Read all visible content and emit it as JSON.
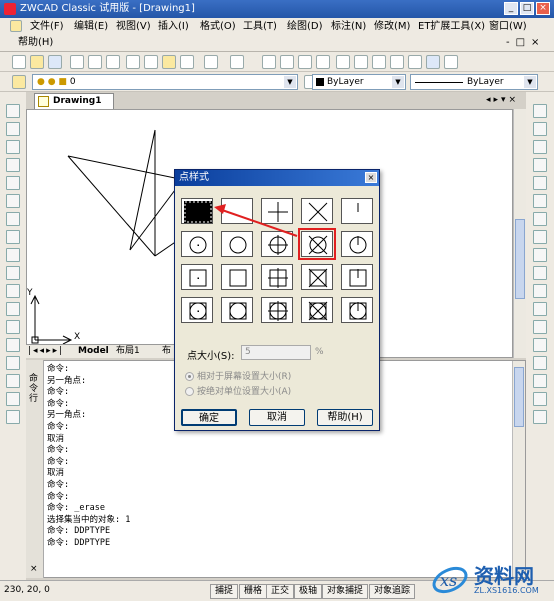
{
  "window": {
    "title": "ZWCAD Classic 试用版 - [Drawing1]"
  },
  "menu": {
    "row1": [
      "文件(F)",
      "编辑(E)",
      "视图(V)",
      "插入(I)",
      "格式(O)",
      "工具(T)",
      "绘图(D)",
      "标注(N)",
      "修改(M)",
      "ET扩展工具(X)",
      "窗口(W)"
    ],
    "row2": [
      "帮助(H)"
    ]
  },
  "properties_bar": {
    "layer_value": "0",
    "color_combo": "ByLayer",
    "linetype_combo": "ByLayer"
  },
  "document": {
    "tab_title": "Drawing1"
  },
  "layout_tabs": [
    "Model",
    "布局1",
    "布"
  ],
  "command_panel_label": "命令行",
  "command_lines": [
    "命令:",
    "另一角点:",
    "命令:",
    "命令:",
    "另一角点:",
    "命令:",
    "取消",
    "命令:",
    "命令:",
    "取消",
    "命令:",
    "命令:",
    "命令: _erase",
    "选择集当中的对象: 1",
    "命令: DDPTYPE",
    "命令: DDPTYPE"
  ],
  "statusbar": {
    "coords": "230, 20, 0",
    "buttons": [
      "捕捉",
      "栅格",
      "正交",
      "极轴",
      "对象捕捉",
      "对象追踪"
    ]
  },
  "dialog": {
    "title": "点样式",
    "close_glyph": "×",
    "size_label": "点大小(S):",
    "size_value": "5",
    "size_unit": "%",
    "radio1": "相对于屏幕设置大小(R)",
    "radio2": "按绝对单位设置大小(A)",
    "ok": "确定",
    "cancel": "取消",
    "help": "帮助(H)",
    "selected_style_index": 0,
    "highlight_index": 8,
    "highlight_color": "#e02020"
  },
  "axes": {
    "x": "X",
    "y": "Y"
  },
  "watermark": {
    "text": "资料网",
    "url_text": "ZL.XS1616.COM"
  }
}
